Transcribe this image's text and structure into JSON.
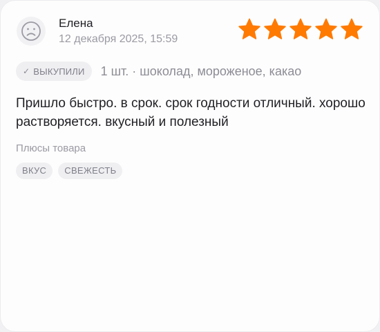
{
  "review": {
    "author": "Елена",
    "date": "12 декабря 2025, 15:59",
    "rating": 5,
    "rating_max": 5,
    "star_color": "#ff7a00",
    "avatar_icon": "sad-face-icon",
    "bought_badge": "ВЫКУПИЛИ",
    "variant": "1 шт. · шоколад, мороженое, какао",
    "text": "Пришло быстро. в срок. срок годности отличный. хорошо растворяется. вкусный и полезный",
    "pros_label": "Плюсы товара",
    "pros_tags": [
      "ВКУС",
      "СВЕЖЕСТЬ"
    ]
  }
}
